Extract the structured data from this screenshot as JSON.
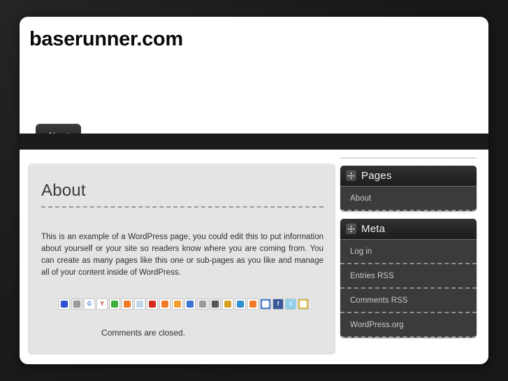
{
  "site": {
    "title": "baserunner.com"
  },
  "nav": {
    "tabs": [
      {
        "label": "About"
      }
    ]
  },
  "content": {
    "entry_title": "About",
    "entry_text": "This is an example of a WordPress page, you could edit this to put information about yourself or your site so readers know where you are coming from. You can create as many pages like this one or sub-pages as you like and manage all of your content inside of WordPress.",
    "comments_note": "Comments are closed.",
    "share_icons": [
      {
        "name": "delicious-icon",
        "glyph": "",
        "bg": "#ffffff",
        "fg": "#2b50d0"
      },
      {
        "name": "digg-icon",
        "glyph": "",
        "bg": "#e9e9e9",
        "fg": "#9a9a9a"
      },
      {
        "name": "google-icon",
        "glyph": "G",
        "bg": "#ffffff",
        "fg": "#3b74d4"
      },
      {
        "name": "yahoo-icon",
        "glyph": "Y",
        "bg": "#ffffff",
        "fg": "#d02020"
      },
      {
        "name": "technorati-icon",
        "glyph": "",
        "bg": "#ffffff",
        "fg": "#3bb03b"
      },
      {
        "name": "stumbleupon-icon",
        "glyph": "",
        "bg": "#ffffff",
        "fg": "#ef7b26"
      },
      {
        "name": "newsvine-icon",
        "glyph": "",
        "bg": "#ffffff",
        "fg": "#bdd8ec"
      },
      {
        "name": "reddit-icon",
        "glyph": "",
        "bg": "#ffffff",
        "fg": "#d42b1e"
      },
      {
        "name": "mixx-icon",
        "glyph": "",
        "bg": "#ffffff",
        "fg": "#ef7b26"
      },
      {
        "name": "propeller-icon",
        "glyph": "",
        "bg": "#ffffff",
        "fg": "#f0a030"
      },
      {
        "name": "simpy-icon",
        "glyph": "",
        "bg": "#ffffff",
        "fg": "#3b74d4"
      },
      {
        "name": "squidoo-icon",
        "glyph": "",
        "bg": "#f0f0f0",
        "fg": "#9a9a9a"
      },
      {
        "name": "magnolia-icon",
        "glyph": "",
        "bg": "#e9e9e9",
        "fg": "#555555"
      },
      {
        "name": "blinklist-icon",
        "glyph": "",
        "bg": "#ffffff",
        "fg": "#d8a020"
      },
      {
        "name": "furl-icon",
        "glyph": "",
        "bg": "#ffffff",
        "fg": "#2f8fd0"
      },
      {
        "name": "rss-icon",
        "glyph": "",
        "bg": "#ffffff",
        "fg": "#ef7b26"
      },
      {
        "name": "friendfeed-icon",
        "glyph": "",
        "bg": "#4a7fd0",
        "fg": "#ffffff"
      },
      {
        "name": "facebook-icon",
        "glyph": "f",
        "bg": "#3b5998",
        "fg": "#ffffff"
      },
      {
        "name": "twitter-icon",
        "glyph": "t",
        "bg": "#8fd0ea",
        "fg": "#ffffff"
      },
      {
        "name": "email-icon",
        "glyph": "",
        "bg": "#d8b84a",
        "fg": "#ffffff"
      }
    ]
  },
  "sidebar": {
    "widgets": [
      {
        "title": "Pages",
        "items": [
          {
            "label": "About"
          }
        ]
      },
      {
        "title": "Meta",
        "items": [
          {
            "label": "Log in"
          },
          {
            "label": "Entries RSS"
          },
          {
            "label": "Comments RSS"
          },
          {
            "label": "WordPress.org"
          }
        ]
      }
    ]
  },
  "colors": {
    "page_background": "#1b1b1b",
    "container": "#ffffff",
    "content_panel": "#e4e4e4",
    "widget_header": "#262626",
    "widget_body": "#3b3b3b",
    "tab_active": "#2a2a2a"
  }
}
